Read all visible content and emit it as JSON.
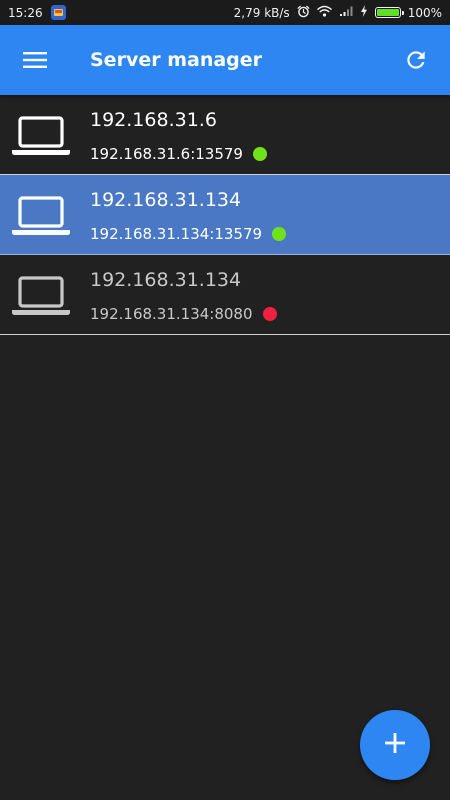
{
  "status_bar": {
    "time": "15:26",
    "net_speed": "2,79 kB/s",
    "battery_percent": "100%",
    "battery_level": 1.0,
    "battery_color": "#5fe024",
    "icons": [
      "app-notification-icon",
      "alarm-icon",
      "wifi-icon",
      "signal-icon",
      "charging-icon",
      "battery-icon"
    ]
  },
  "app_bar": {
    "title": "Server manager",
    "color": "#2d86f1",
    "menu_icon": "hamburger-menu-icon",
    "refresh_icon": "refresh-icon"
  },
  "servers": [
    {
      "name": "192.168.31.6",
      "address": "192.168.31.6:13579",
      "status": "online",
      "status_color": "#6fe21b",
      "selected": false,
      "icon": "laptop-icon"
    },
    {
      "name": "192.168.31.134",
      "address": "192.168.31.134:13579",
      "status": "online",
      "status_color": "#6fe21b",
      "selected": true,
      "icon": "laptop-icon"
    },
    {
      "name": "192.168.31.134",
      "address": "192.168.31.134:8080",
      "status": "offline",
      "status_color": "#f0213f",
      "selected": false,
      "icon": "laptop-icon"
    }
  ],
  "fab": {
    "icon": "plus-icon",
    "color": "#2d86f1"
  }
}
